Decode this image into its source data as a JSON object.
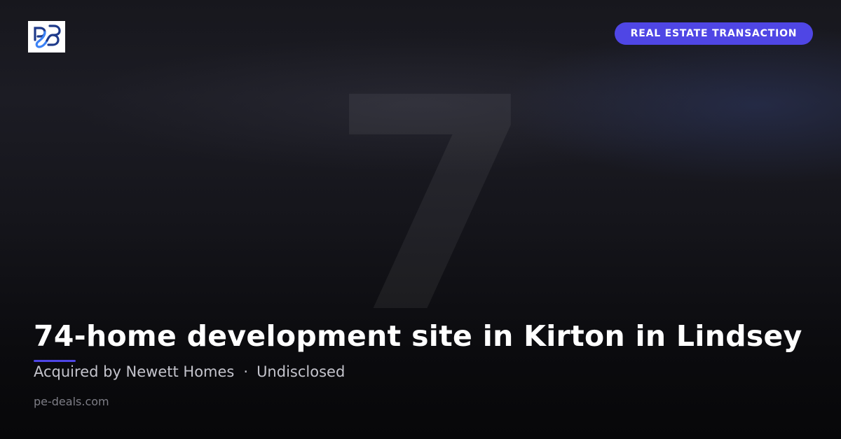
{
  "header": {
    "logo_icon": "pe-deals-logo-icon",
    "tag_label": "REAL ESTATE TRANSACTION"
  },
  "background": {
    "watermark_number": "7"
  },
  "deal": {
    "title": "74-home development site in Kirton in Lindsey",
    "acquirer_text": "Acquired by Newett Homes",
    "separator": "·",
    "value": "Undisclosed"
  },
  "footer": {
    "site": "pe-deals.com"
  },
  "colors": {
    "accent": "#4f46e5",
    "logo_blue": "#1e3a8a",
    "logo_light_blue": "#3b82f6"
  }
}
